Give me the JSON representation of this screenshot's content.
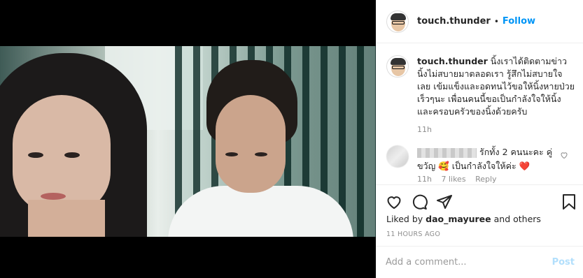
{
  "post": {
    "username": "touch.thunder",
    "follow_label": "Follow",
    "separator": "•"
  },
  "caption": {
    "username": "touch.thunder",
    "text": "นิ้งเราได้ติดตามข่าว นิ้งไม่สบายมาตลอดเรา รู้สึกไม่สบายใจเลย เข้มแข็งและอดทนไว้ขอให้นิ้งหายป่วยเร็วๆนะ เพื่อนคนนี้ขอเป็นกำลังใจให้นิ้ง และครอบครัวของนิ้งด้วยครับ",
    "time": "11h"
  },
  "comment2": {
    "text": "รักทั้ง 2 คนนะคะ คู่ขวัญ 🥰 เป็นกำลังใจให้ค่ะ ❤️",
    "time": "11h",
    "likes": "7 likes",
    "reply": "Reply"
  },
  "footer": {
    "liked_by_prefix": "Liked by",
    "liked_by_user": "dao_mayuree",
    "liked_by_suffix": "and others",
    "ago": "11 HOURS AGO",
    "comment_placeholder": "Add a comment...",
    "post_label": "Post"
  },
  "icons": {
    "like": "heart-icon",
    "comment": "comment-icon",
    "share": "share-icon",
    "save": "bookmark-icon"
  },
  "colors": {
    "accent": "#0095f6",
    "post_disabled": "#b2dffc",
    "muted": "#8e8e8e"
  }
}
